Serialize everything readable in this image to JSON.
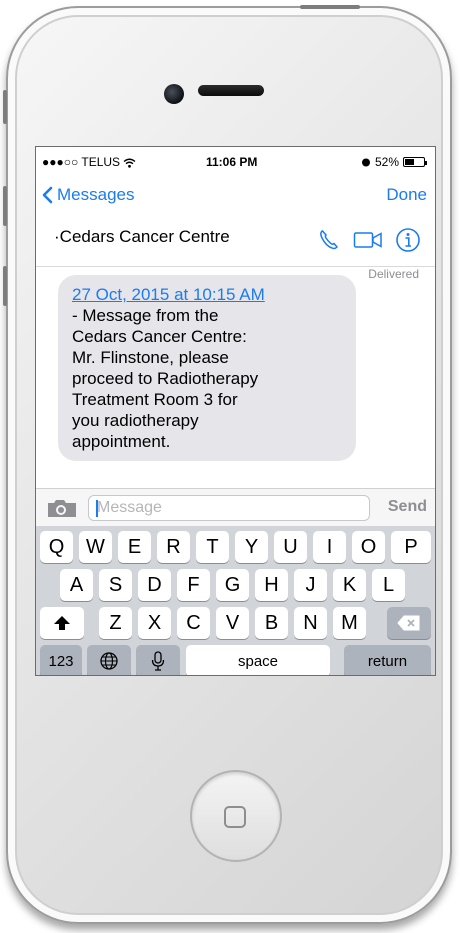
{
  "status_bar": {
    "carrier": "●●●○○ TELUS",
    "time": "11:06 PM",
    "battery": "52%",
    "battery_level": 0.52
  },
  "nav": {
    "back_label": "Messages",
    "done_label": "Done"
  },
  "contact": {
    "name": "·Cedars Cancer Centre",
    "icons": [
      "phone-icon",
      "video-icon",
      "info-icon"
    ]
  },
  "thread": {
    "status": "Delivered",
    "message": {
      "timestamp_link": "27 Oct, 2015 at 10:15 AM",
      "lines": [
        "- Message from the",
        "Cedars Cancer Centre:",
        "Mr. Flinstone, please",
        "proceed to Radiotherapy",
        "Treatment Room 3 for",
        "you radiotherapy",
        "appointment."
      ]
    }
  },
  "composer": {
    "placeholder": "Message",
    "value": "",
    "send_label": "Send"
  },
  "keyboard": {
    "row1": [
      "Q",
      "W",
      "E",
      "R",
      "T",
      "Y",
      "U",
      "I",
      "O",
      "P"
    ],
    "row2": [
      "A",
      "S",
      "D",
      "F",
      "G",
      "H",
      "J",
      "K",
      "L"
    ],
    "row3": [
      "Z",
      "X",
      "C",
      "V",
      "B",
      "N",
      "M"
    ],
    "numbers_label": "123",
    "space_label": "space",
    "return_label": "return"
  },
  "colors": {
    "accent": "#1a7cf2",
    "bubble": "#e5e5ea",
    "keyboard_bg": "#d1d4d9"
  }
}
